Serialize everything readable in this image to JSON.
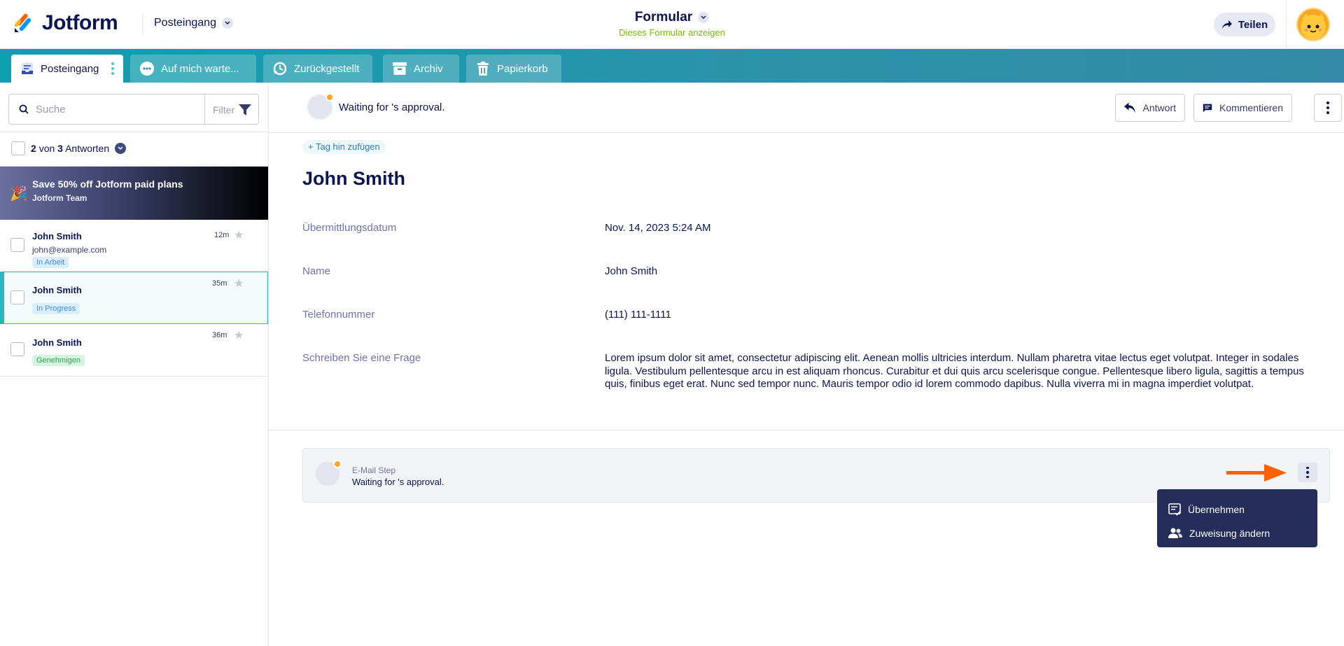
{
  "header": {
    "logo_text": "Jotform",
    "inbox_switch_label": "Posteingang",
    "form_title": "Formular",
    "form_subtitle": "Dieses Formular anzeigen",
    "share_label": "Teilen"
  },
  "tabs": [
    {
      "label": "Posteingang",
      "active": true
    },
    {
      "label": "Auf mich warte..."
    },
    {
      "label": "Zurückgestellt"
    },
    {
      "label": "Archiv"
    },
    {
      "label": "Papierkorb"
    }
  ],
  "search": {
    "placeholder": "Suche",
    "filter_label": "Filter"
  },
  "count": {
    "shown": "2",
    "of_text": "von",
    "total": "3",
    "suffix": "Antworten"
  },
  "promo": {
    "title": "Save 50% off Jotform paid plans",
    "subtitle": "Jotform Team",
    "emoji": "🎉"
  },
  "submissions": [
    {
      "name": "John Smith",
      "email": "john@example.com",
      "time": "12m",
      "badge": "In Arbeit",
      "badge_color": "blue"
    },
    {
      "name": "John Smith",
      "time": "35m",
      "badge": "In Progress",
      "badge_color": "blue",
      "selected": true
    },
    {
      "name": "John Smith",
      "time": "36m",
      "badge": "Genehmigen",
      "badge_color": "green"
    }
  ],
  "detail": {
    "waiting_text": "Waiting for 's approval.",
    "reply_label": "Antwort",
    "comment_label": "Kommentieren",
    "tag_add_label": "Tag hin zufügen",
    "heading": "John Smith",
    "fields": [
      {
        "label": "Übermittlungsdatum",
        "value": "Nov. 14, 2023 5:24 AM"
      },
      {
        "label": "Name",
        "value": "John Smith"
      },
      {
        "label": "Telefonnummer",
        "value": "(111) 111-1111"
      },
      {
        "label": "Schreiben Sie eine Frage",
        "value": "Lorem ipsum dolor sit amet, consectetur adipiscing elit. Aenean mollis ultricies interdum. Nullam pharetra vitae lectus eget volutpat. Integer in sodales ligula. Vestibulum pellentesque arcu in est aliquam rhoncus. Curabitur et dui quis arcu scelerisque congue. Pellentesque libero ligula, sagittis a tempus quis, finibus eget erat. Nunc sed tempor nunc. Mauris tempor odio id lorem commodo dapibus. Nulla viverra mi in magna imperdiet volutpat."
      }
    ],
    "step": {
      "name": "E-Mail Step",
      "waiting_text": "Waiting for 's approval."
    },
    "menu": [
      {
        "label": "Übernehmen",
        "icon": "take-over-icon"
      },
      {
        "label": "Zuweisung ändern",
        "icon": "reassign-icon"
      }
    ]
  },
  "colors": {
    "accent_teal": "#2db5bd",
    "menu_bg": "#252d5b",
    "arrow": "#ff6100",
    "subtitle_green": "#78bb07"
  }
}
